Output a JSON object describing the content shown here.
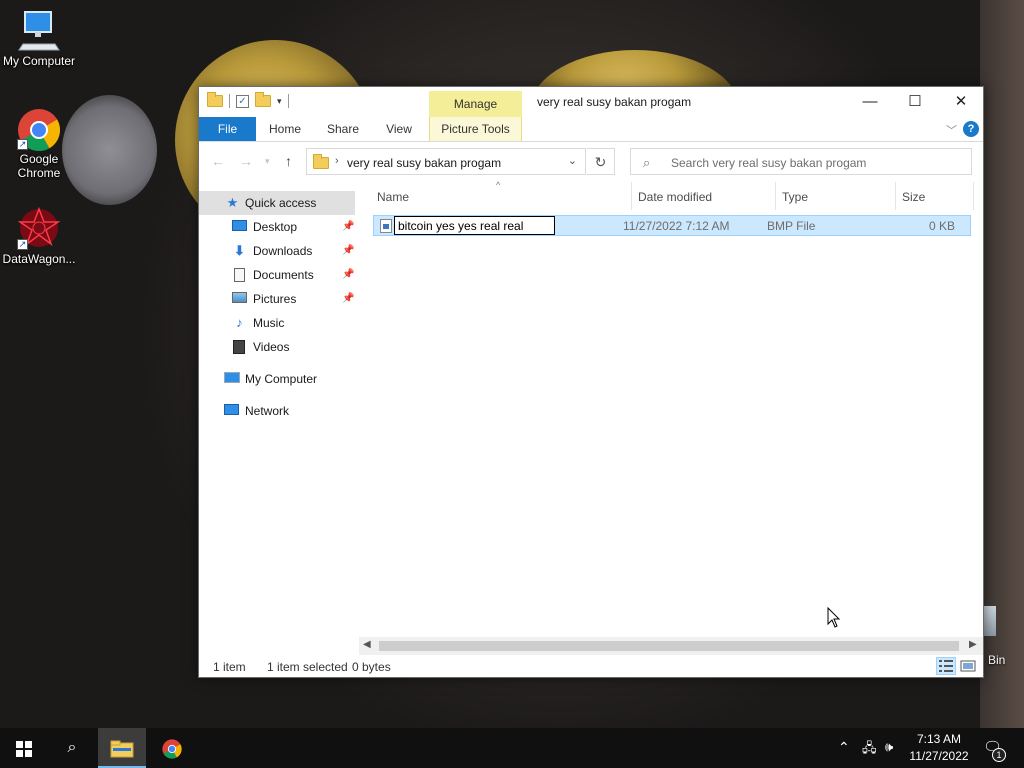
{
  "desktop": {
    "icons": [
      {
        "label": "My Computer",
        "icon": "monitor-icon"
      },
      {
        "label": "Google Chrome",
        "icon": "chrome-icon"
      },
      {
        "label": "DataWagon...",
        "icon": "datawagon-icon"
      }
    ],
    "recycle_bin_label": "Bin"
  },
  "window": {
    "title": "very real susy bakan progam",
    "contextual_tab": "Manage",
    "ribbon_tabs": [
      "File",
      "Home",
      "Share",
      "View",
      "Picture Tools"
    ],
    "controls": {
      "minimize": "—",
      "maximize": "☐",
      "close": "✕"
    },
    "help_label": "?"
  },
  "address_bar": {
    "breadcrumb": "very real susy bakan progam",
    "search_placeholder": "Search very real susy bakan progam"
  },
  "nav_pane": {
    "items": [
      {
        "label": "Quick access",
        "icon": "star-icon",
        "pinned": false,
        "selected": true
      },
      {
        "label": "Desktop",
        "icon": "desktop-icon",
        "pinned": true
      },
      {
        "label": "Downloads",
        "icon": "download-icon",
        "pinned": true
      },
      {
        "label": "Documents",
        "icon": "document-icon",
        "pinned": true
      },
      {
        "label": "Pictures",
        "icon": "picture-icon",
        "pinned": true
      },
      {
        "label": "Music",
        "icon": "music-icon",
        "pinned": false
      },
      {
        "label": "Videos",
        "icon": "video-icon",
        "pinned": false
      },
      {
        "label": "My Computer",
        "icon": "computer-icon",
        "pinned": false
      },
      {
        "label": "Network",
        "icon": "network-icon",
        "pinned": false
      }
    ]
  },
  "file_list": {
    "columns": [
      "Name",
      "Date modified",
      "Type",
      "Size"
    ],
    "rows": [
      {
        "name": "bitcoin yes yes real real ",
        "date": "11/27/2022 7:12 AM",
        "type": "BMP File",
        "size": "0 KB",
        "renaming": true
      }
    ]
  },
  "status_bar": {
    "item_count": "1 item",
    "selection": "1 item selected",
    "size": "0 bytes"
  },
  "taskbar": {
    "time": "7:13 AM",
    "date": "11/27/2022",
    "notification_count": "1"
  },
  "colors": {
    "file_tab": "#1979ca",
    "manage_tab": "#f4ee98",
    "selection": "#cce8ff",
    "taskbar": "#101010"
  }
}
